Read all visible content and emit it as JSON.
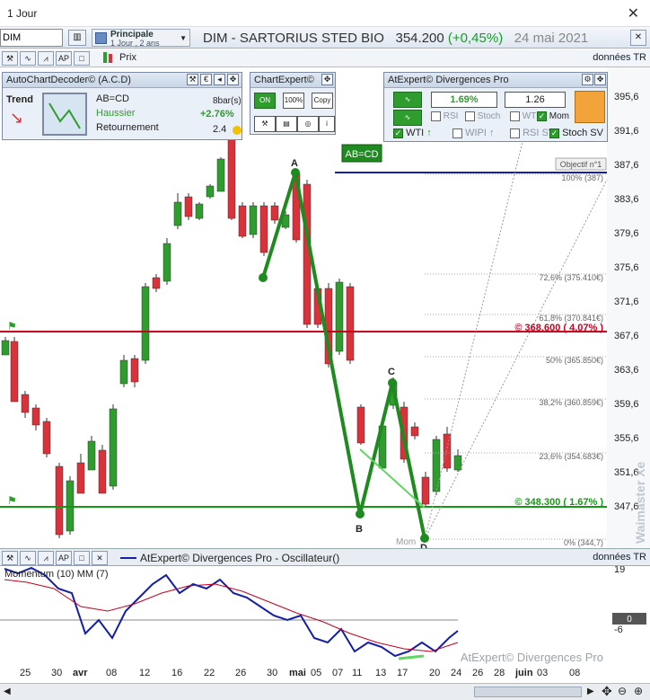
{
  "window": {
    "title": "1 Jour",
    "close_glyph": "✕"
  },
  "toolbar": {
    "symbol_value": "DIM",
    "period_line1": "Principale",
    "period_line2": "1 Jour , 2 ans",
    "stock_name": "DIM - SARTORIUS STED BIO",
    "price": "354.200",
    "change": "(+0,45%)",
    "date": "24 mai 2021"
  },
  "subbar": {
    "prix_label": "Prix",
    "donnees": "données TR"
  },
  "acd_panel": {
    "title": "AutoChartDecoder© (A.C.D)",
    "trend_label": "Trend",
    "pattern": "AB=CD",
    "direction": "Haussier",
    "retracement": "Retournement",
    "bars": "8bar(s)",
    "pct": "+2.76%",
    "score": "2.4"
  },
  "chartexpert_panel": {
    "title": "ChartExpert©"
  },
  "divergence_panel": {
    "title": "AtExpert© Divergences Pro",
    "pct": "1.69%",
    "val": "1.26",
    "rsi": "RSI",
    "stoch": "Stoch",
    "wti1": "WTI",
    "mom": "Mom",
    "wti2": "WTI",
    "wipi": "WIPI",
    "rsi_sv": "RSI SV",
    "stoch_sv": "Stoch SV"
  },
  "chart_labels": {
    "abcd_tag": "AB=CD",
    "objectif": "Objectif n°1",
    "pt_a": "A",
    "pt_b": "B",
    "pt_c": "C",
    "pt_d": "D",
    "mom_tag": "Mom",
    "watermark": "Waimaster Xe",
    "resistance": "© 368.600 ( 4.07% )",
    "support": "© 348.300 ( 1.67% )"
  },
  "fib_levels": [
    {
      "label": "100% (387)"
    },
    {
      "label": "72,6% (375.410€)"
    },
    {
      "label": "61,8% (370.841€)"
    },
    {
      "label": "50% (365.850€)"
    },
    {
      "label": "38,2% (360.859€)"
    },
    {
      "label": "23,6% (354.683€)"
    },
    {
      "label": "0% (344,7)"
    }
  ],
  "price_axis": [
    "395,6",
    "391,6",
    "387,6",
    "383,6",
    "379,6",
    "375,6",
    "371,6",
    "367,6",
    "363,6",
    "359,6",
    "355,6",
    "351,6",
    "347,6"
  ],
  "oscillator": {
    "bar_title": "AtExpert© Divergences Pro - Oscillateur()",
    "donnees": "données TR",
    "indicator_label": "Momentum (10) MM (7)",
    "axis": [
      "19",
      "0",
      "-6"
    ],
    "watermark": "AtExpert© Divergences Pro"
  },
  "x_axis": [
    "25",
    "30",
    "avr",
    "08",
    "12",
    "16",
    "22",
    "26",
    "30",
    "mai",
    "05",
    "07",
    "11",
    "13",
    "17",
    "20",
    "24",
    "26",
    "28",
    "juin",
    "03",
    "08"
  ],
  "colors": {
    "up": "#2e9d2e",
    "down": "#d9323a",
    "resistance": "#c8001e",
    "support": "#139a13",
    "objective": "#1520a6"
  }
}
